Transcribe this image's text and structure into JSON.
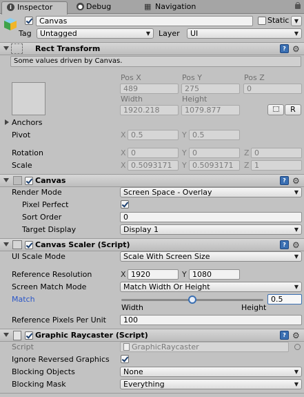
{
  "tabs": [
    {
      "label": "Inspector",
      "icon": "info-icon"
    },
    {
      "label": "Debug",
      "icon": "bug-icon"
    },
    {
      "label": "Navigation",
      "icon": "grid-icon"
    }
  ],
  "object": {
    "name": "Canvas",
    "static_label": "Static",
    "tag_label": "Tag",
    "tag_value": "Untagged",
    "layer_label": "Layer",
    "layer_value": "UI"
  },
  "rect_transform": {
    "title": "Rect Transform",
    "note": "Some values driven by Canvas.",
    "posx_label": "Pos X",
    "posy_label": "Pos Y",
    "posz_label": "Pos Z",
    "posx": "489",
    "posy": "275",
    "posz": "0",
    "width_label": "Width",
    "height_label": "Height",
    "width": "1920.218",
    "height": "1079.877",
    "r_button": "R",
    "anchors_label": "Anchors",
    "pivot_label": "Pivot",
    "pivot_x": "0.5",
    "pivot_y": "0.5",
    "rotation_label": "Rotation",
    "rot_x": "0",
    "rot_y": "0",
    "rot_z": "0",
    "scale_label": "Scale",
    "scale_x": "0.5093171",
    "scale_y": "0.5093171",
    "scale_z": "1"
  },
  "axis": {
    "x": "X",
    "y": "Y",
    "z": "Z"
  },
  "canvas": {
    "title": "Canvas",
    "render_mode_label": "Render Mode",
    "render_mode": "Screen Space - Overlay",
    "pixel_perfect_label": "Pixel Perfect",
    "sort_order_label": "Sort Order",
    "sort_order": "0",
    "target_display_label": "Target Display",
    "target_display": "Display 1"
  },
  "scaler": {
    "title": "Canvas Scaler (Script)",
    "ui_scale_mode_label": "UI Scale Mode",
    "ui_scale_mode": "Scale With Screen Size",
    "ref_res_label": "Reference Resolution",
    "ref_x": "1920",
    "ref_y": "1080",
    "match_mode_label": "Screen Match Mode",
    "match_mode": "Match Width Or Height",
    "match_label": "Match",
    "match_value": "0.5",
    "match_fraction": 0.5,
    "width_label": "Width",
    "height_label": "Height",
    "ppu_label": "Reference Pixels Per Unit",
    "ppu": "100"
  },
  "raycaster": {
    "title": "Graphic Raycaster (Script)",
    "script_label": "Script",
    "script_value": "GraphicRaycaster",
    "ignore_label": "Ignore Reversed Graphics",
    "blocking_objects_label": "Blocking Objects",
    "blocking_objects": "None",
    "blocking_mask_label": "Blocking Mask",
    "blocking_mask": "Everything"
  },
  "colors": {
    "accent": "#3a6fb2",
    "match_label": "#2a56c8"
  }
}
